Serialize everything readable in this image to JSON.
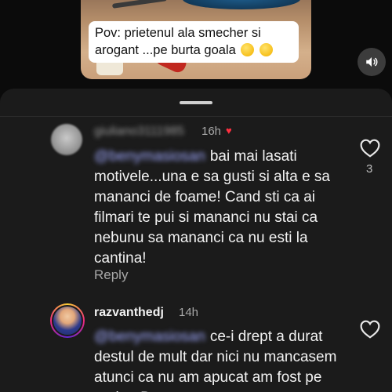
{
  "video": {
    "caption": "Pov: prietenul ala smecher si arogant ...pe burta goala",
    "sound_icon": "speaker-icon"
  },
  "comments": [
    {
      "username": "giuliano3111985",
      "time": "16h",
      "creator_liked": true,
      "mention": "@benymasiosan",
      "text": "bai mai lasati motivele...una e sa gusti si alta e sa mananci de foame! Cand sti ca ai filmari te pui si mananci nu stai ca nebunu sa mananci ca nu esti la cantina!",
      "reply_label": "Reply",
      "like_count": "3",
      "like_icon": "heart-outline-icon"
    },
    {
      "username": "razvanthedj",
      "time": "14h",
      "creator_liked": false,
      "mention": "@benymasiosan",
      "text": "ce-i drept a durat destul de mult dar nici nu mancasem atunci ca nu am apucat am fost pe graba. Dar",
      "like_icon": "heart-outline-icon"
    }
  ],
  "colors": {
    "background": "#121212",
    "sheet": "#1b1b1b",
    "mention": "#9fa8ff",
    "liked_red": "#ff3040",
    "muted": "#a8a8a8"
  }
}
